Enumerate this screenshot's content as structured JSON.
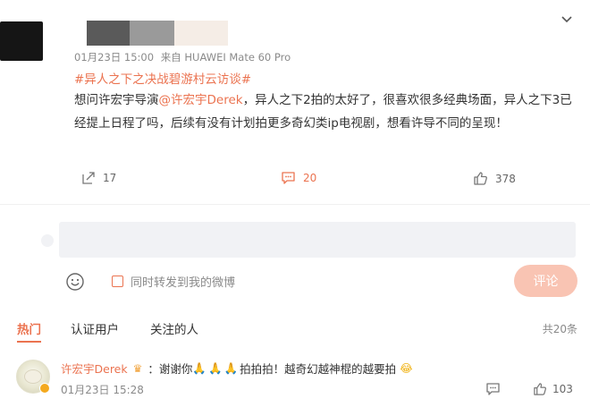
{
  "post": {
    "timestamp": "01月23日 15:00",
    "source": "来自 HUAWEI Mate 60 Pro",
    "topic": "#异人之下之决战碧游村云访谈#",
    "content_before": "想问许宏宇导演",
    "mention": "@许宏宇Derek",
    "content_after": "，异人之下2拍的太好了，很喜欢很多经典场面，异人之下3已经提上日程了吗，后续有没有计划拍更多奇幻类ip电视剧，想看许导不同的呈现！",
    "repost_count": "17",
    "comment_count": "20",
    "like_count": "378"
  },
  "composer": {
    "placeholder": "",
    "repost_option": "同时转发到我的微博",
    "submit_label": "评论"
  },
  "tabs": {
    "hot": "热门",
    "verified": "认证用户",
    "following": "关注的人",
    "total": "共20条"
  },
  "comment": {
    "user": "许宏宇Derek",
    "separator": "：",
    "text1": "谢谢你",
    "emoji_hands": "🙏🙏🙏",
    "text2": " 拍拍拍！越奇幻越神棍的越要拍",
    "emoji_laugh": "😂",
    "timestamp": "01月23日 15:28",
    "like_count": "103"
  },
  "icons": {
    "more": "chevron-down-icon",
    "repost": "share-arrow-icon",
    "comment": "comment-bubble-icon",
    "like": "thumbs-up-icon",
    "emoji": "smiley-icon",
    "crown": "crown-icon"
  },
  "colors": {
    "accent": "#eb7350",
    "submit_disabled": "#f9c4b3",
    "input_bg": "#f1f2f5",
    "muted": "#8a8a8a"
  }
}
